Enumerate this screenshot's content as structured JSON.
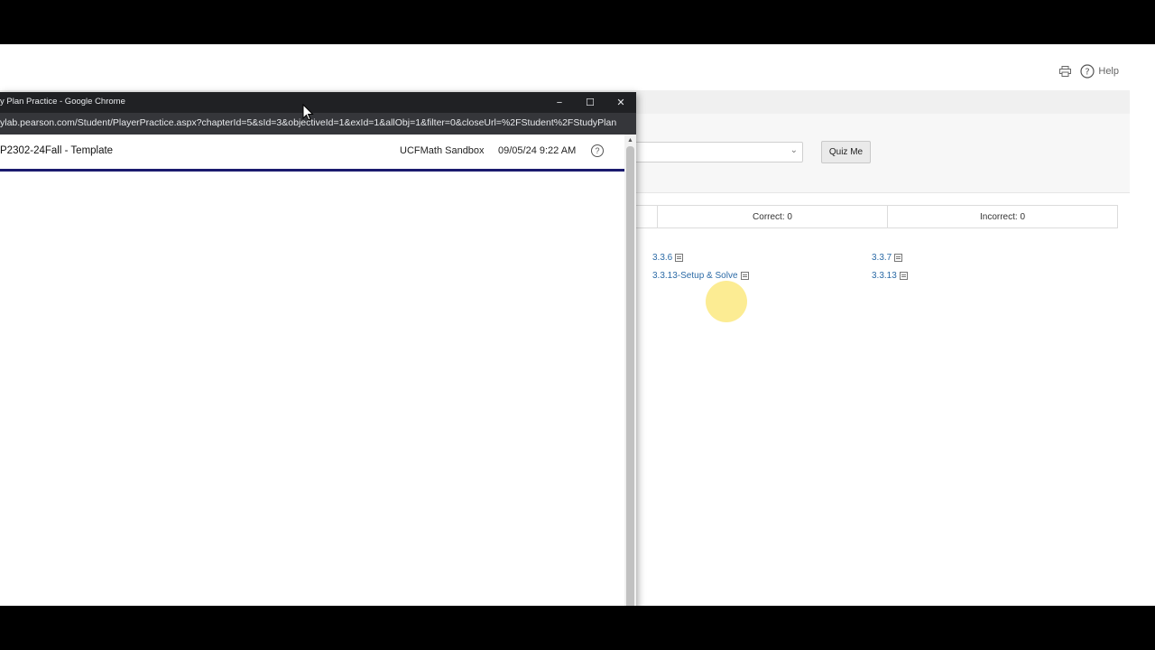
{
  "browser": {
    "window_title": "y Plan Practice - Google Chrome",
    "url": "ylab.pearson.com/Student/PlayerPractice.aspx?chapterId=5&sId=3&objectiveId=1&exId=1&allObj=1&filter=0&closeUrl=%2FStudent%2FStudyPlan...",
    "controls": {
      "minimize": "−",
      "maximize": "☐",
      "close": "✕"
    }
  },
  "player": {
    "course_title": "P2302-24Fall - Template",
    "course_name": "UCFMath Sandbox",
    "datetime": "09/05/24 9:22 AM",
    "help_glyph": "?"
  },
  "background_page": {
    "help_label": "Help",
    "quiz_button": "Quiz Me",
    "scores": {
      "correct": "Correct: 0",
      "incorrect": "Incorrect: 0"
    },
    "exercises": [
      "3.3.6",
      "3.3.7",
      "3.3.13-Setup & Solve",
      "3.3.13"
    ]
  },
  "colors": {
    "title_bar": "#202124",
    "address_bar": "#35363a",
    "header_rule": "#1a1a6e",
    "link": "#2b6aa6",
    "cursor_highlight": "#fae150"
  }
}
